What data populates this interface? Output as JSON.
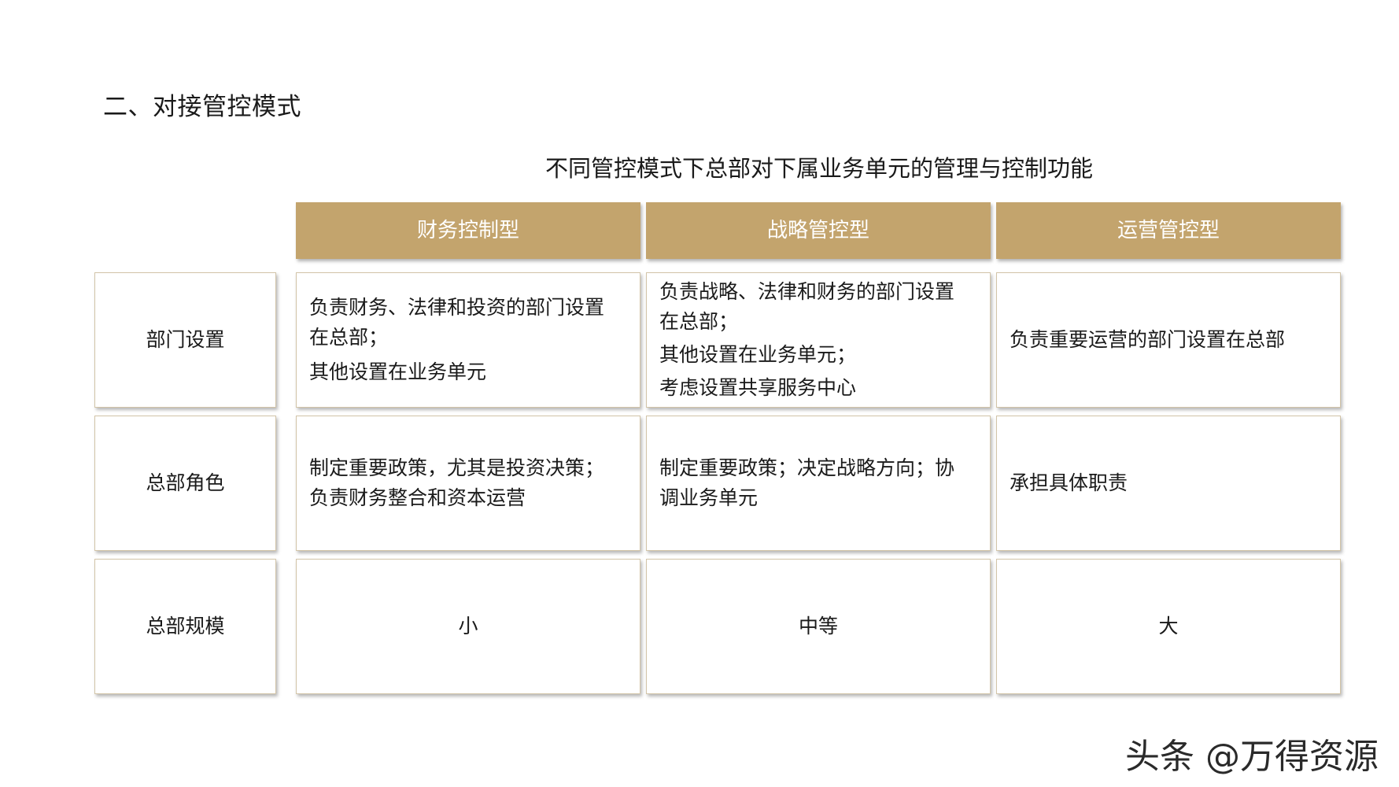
{
  "heading": "二、对接管控模式",
  "subtitle": "不同管控模式下总部对下属业务单元的管理与控制功能",
  "columns": [
    "财务控制型",
    "战略管控型",
    "运营管控型"
  ],
  "rows": [
    {
      "label": "部门设置",
      "cells": [
        [
          "负责财务、法律和投资的部门设置",
          "在总部；",
          "其他设置在业务单元"
        ],
        [
          "负责战略、法律和财务的部门设置",
          "在总部；",
          "其他设置在业务单元；",
          "考虑设置共享服务中心"
        ],
        [
          "负责重要运营的部门设置在总部"
        ]
      ]
    },
    {
      "label": "总部角色",
      "cells": [
        [
          "制定重要政策，尤其是投资决策；",
          "负责财务整合和资本运营"
        ],
        [
          "制定重要政策；决定战略方向；协",
          "调业务单元"
        ],
        [
          "承担具体职责"
        ]
      ]
    },
    {
      "label": "总部规模",
      "cells": [
        [
          "小"
        ],
        [
          "中等"
        ],
        [
          "大"
        ]
      ]
    }
  ],
  "watermark": "头条 @万得资源"
}
